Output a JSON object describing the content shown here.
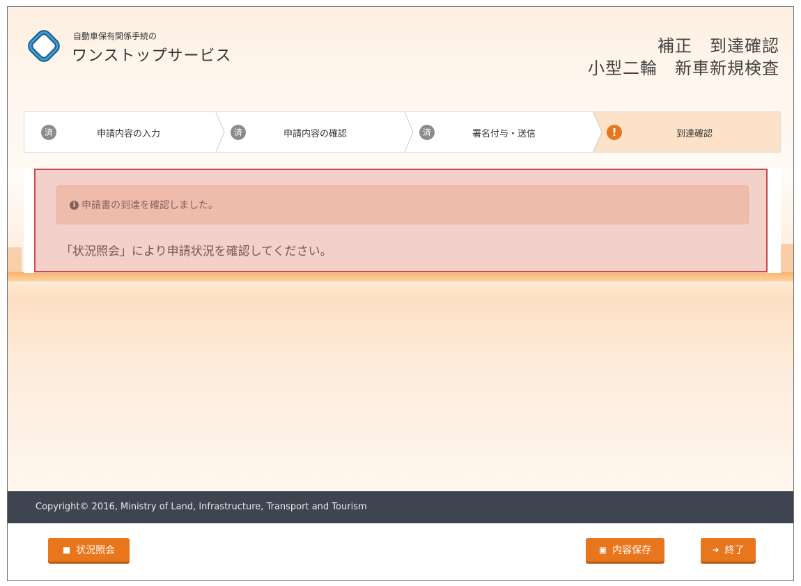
{
  "header": {
    "brand_small": "自動車保有関係手続の",
    "brand_large": "ワンストップサービス",
    "title_line1": "補正　到達確認",
    "title_line2": "小型二輪　新車新規検査"
  },
  "steps": [
    {
      "badge": "済",
      "label": "申請内容の入力"
    },
    {
      "badge": "済",
      "label": "申請内容の確認"
    },
    {
      "badge": "済",
      "label": "署名付与・送信"
    },
    {
      "badge": "!",
      "label": "到達確認"
    }
  ],
  "alert": {
    "text": "申請書の到達を確認しました。"
  },
  "message": "「状況照会」により申請状況を確認してください。",
  "footer": {
    "copyright": "Copyright© 2016, Ministry of Land, Infrastructure, Transport and Tourism"
  },
  "buttons": {
    "status": "状況照会",
    "save": "内容保存",
    "exit": "終了"
  },
  "colors": {
    "accent": "#e8761d",
    "footer_bg": "#3e4450",
    "highlight_border": "#c54b4b"
  }
}
